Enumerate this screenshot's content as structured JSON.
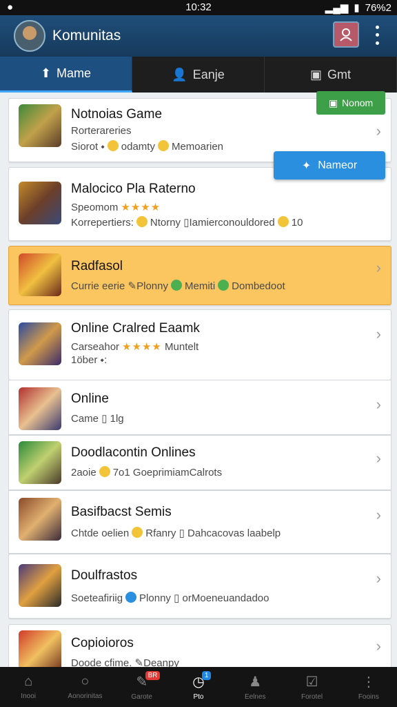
{
  "status": {
    "time": "10:32",
    "battery": "76%2"
  },
  "app": {
    "title": "Komunitas"
  },
  "tabs": [
    {
      "label": "Mame"
    },
    {
      "label": "Eanje"
    },
    {
      "label": "Gmt"
    }
  ],
  "float_green": {
    "label": "Nonom"
  },
  "float_blue": {
    "label": "Nameor"
  },
  "items": [
    {
      "title": "Notnoias Game",
      "line1": "Rorterareries",
      "line2a": "Siorot",
      "line2b": "odamty",
      "line2c": "Memoarien"
    },
    {
      "title": "Malocico Pla Raterno",
      "line1": "Speomom",
      "line2a": "Korrepertiers:",
      "line2b": "Ntorny",
      "line2c": "Iamierconouldored",
      "line2d": "10"
    },
    {
      "title": "Radfasol",
      "line1a": "Currie eerie",
      "line1b": "Plonny",
      "line1c": "Memiti",
      "line1d": "Dombedoot"
    },
    {
      "title": "Online Cralred Eaamk",
      "line1": "Carseahor",
      "line1b": "Muntelt",
      "line2": "1öber"
    },
    {
      "title": "Online",
      "line1": "Came",
      "line1b": "1lg"
    },
    {
      "title": "Doodlacontin Onlines",
      "line1": "2aoie",
      "line1b": "7o1 GoeprimiamCalrots"
    },
    {
      "title": "Basifbacst Semis",
      "line1": "Chtde oelien",
      "line1b": "Rfanry",
      "line1c": "Dahcacovas laabelp"
    },
    {
      "title": "Doulfrastos",
      "line1": "Soeteafiriig",
      "line1b": "Plonny",
      "line1c": "orMoeneuandadoo"
    },
    {
      "title": "Copioioros",
      "line1": "Doode cfime.",
      "line1b": "Deanpy"
    }
  ],
  "bottom_nav": [
    {
      "label": "Inooi",
      "icon": "home-icon"
    },
    {
      "label": "Aonorinitas",
      "icon": "search-icon"
    },
    {
      "label": "Garote",
      "icon": "edit-icon",
      "badge": "BR"
    },
    {
      "label": "Pto",
      "icon": "clock-icon",
      "badge": "1"
    },
    {
      "label": "Eelnes",
      "icon": "person-icon"
    },
    {
      "label": "Forotel",
      "icon": "check-icon"
    },
    {
      "label": "Fooins",
      "icon": "more-icon"
    }
  ]
}
